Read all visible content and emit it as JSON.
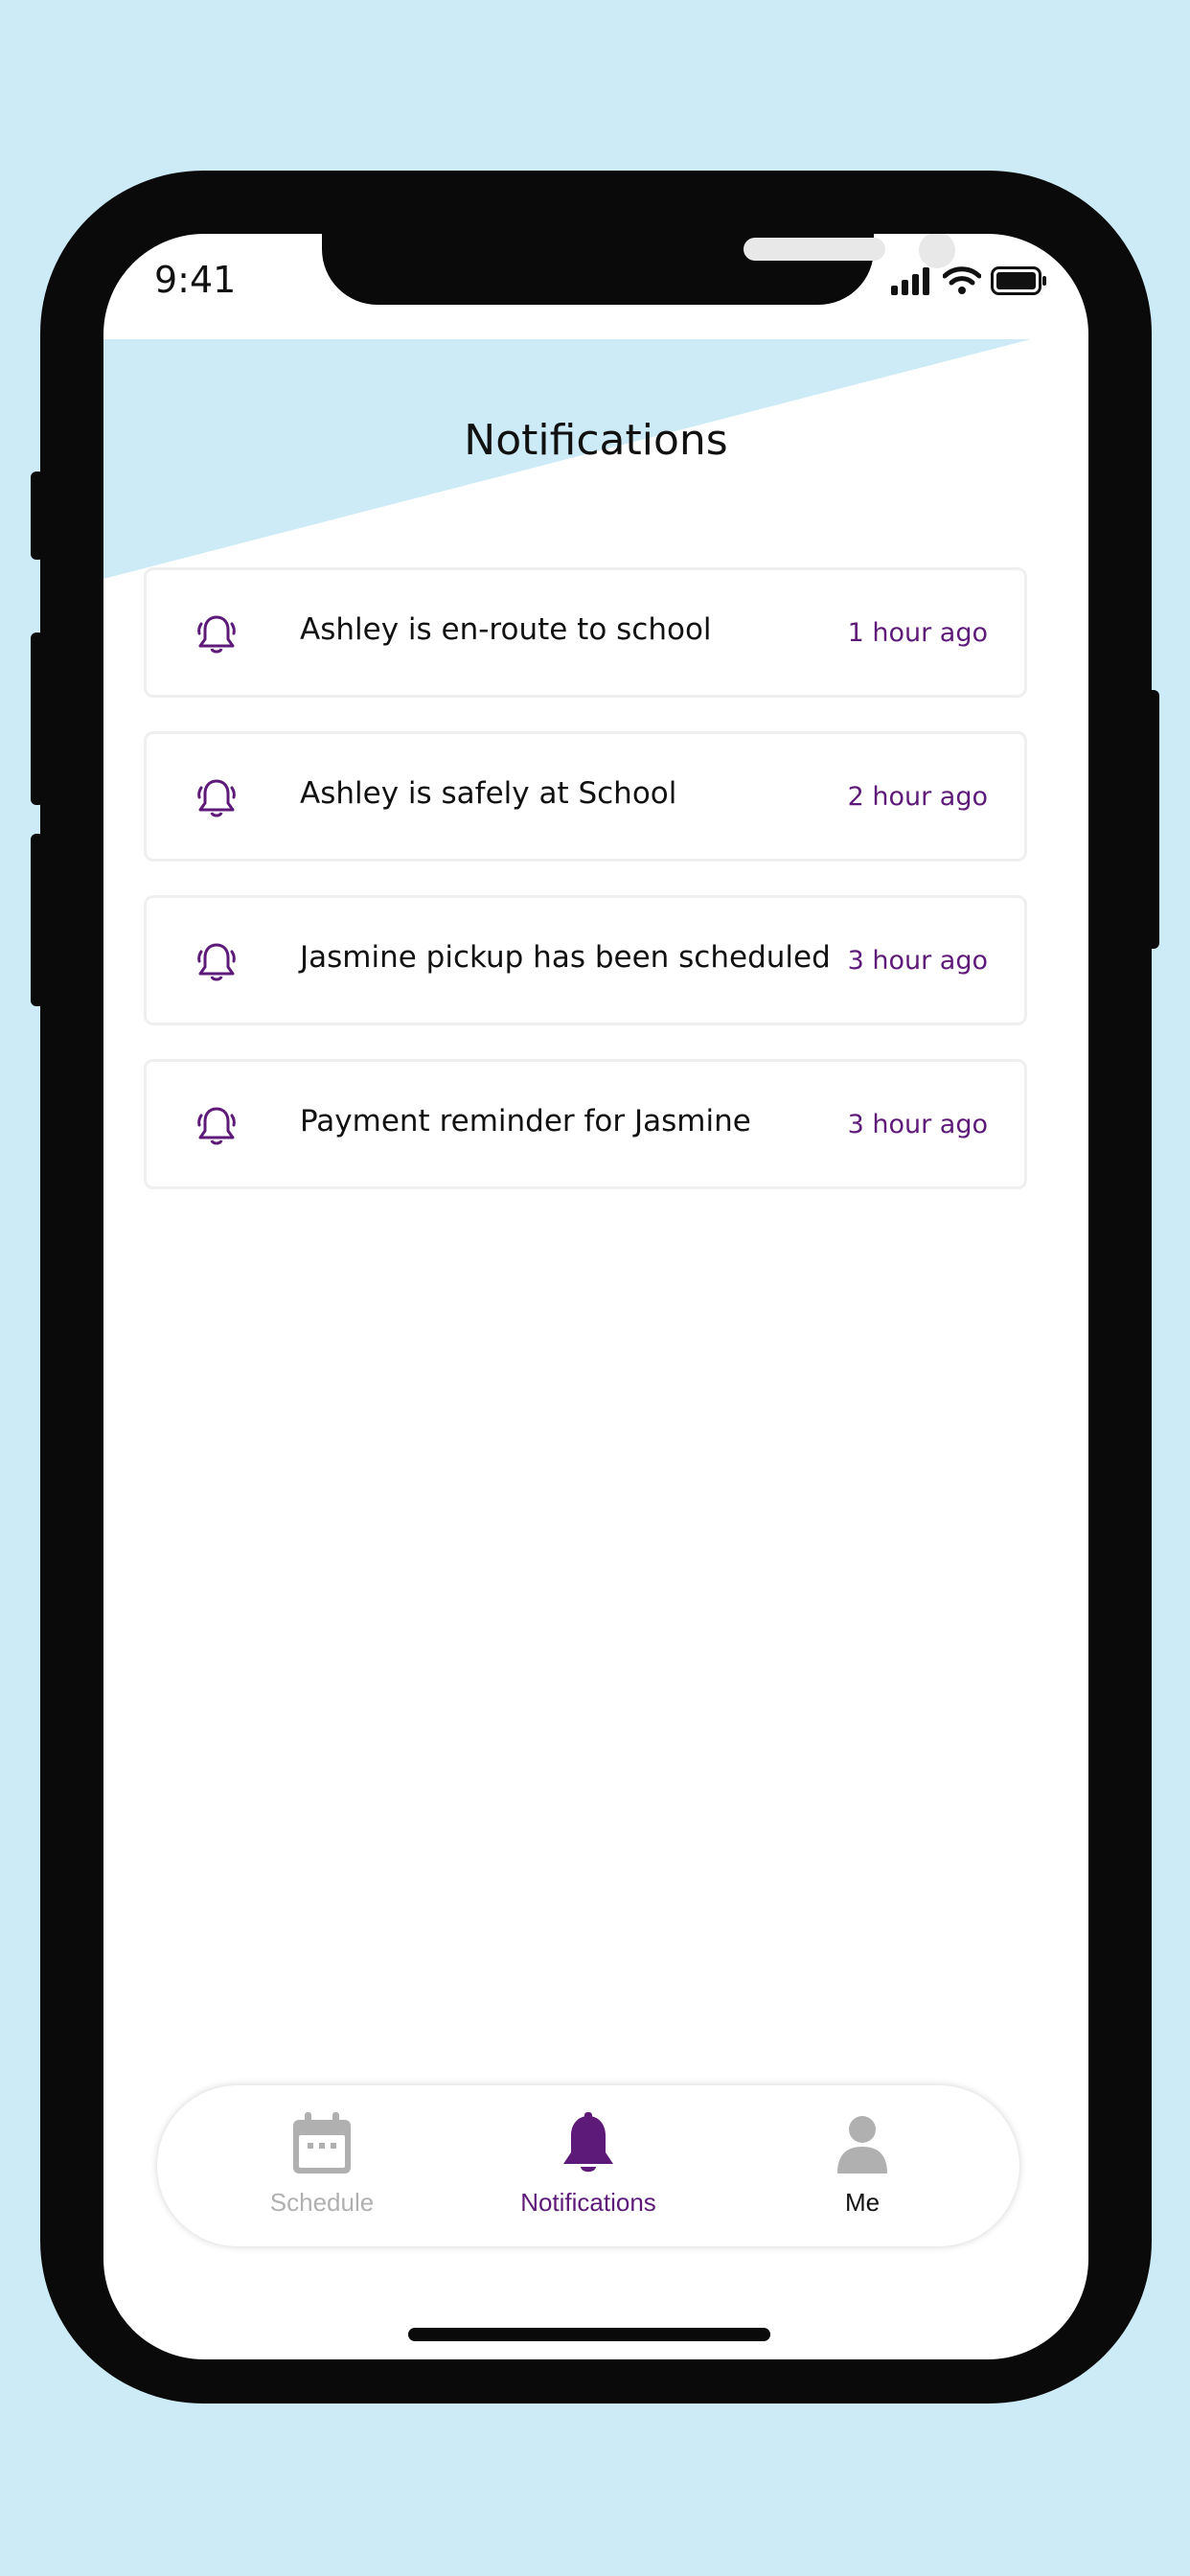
{
  "status_bar": {
    "time": "9:41"
  },
  "header": {
    "title": "Notifications"
  },
  "colors": {
    "accent": "#5e1a78",
    "background": "#cdebf7",
    "inactive": "#b0b0b0"
  },
  "notifications": [
    {
      "icon": "bell-icon",
      "text": "Ashley is en-route to school",
      "time": "1 hour ago"
    },
    {
      "icon": "bell-icon",
      "text": "Ashley is safely at School",
      "time": "2 hour ago"
    },
    {
      "icon": "bell-icon",
      "text": "Jasmine pickup has been scheduled",
      "time": "3 hour ago"
    },
    {
      "icon": "bell-icon",
      "text": "Payment reminder for Jasmine",
      "time": "3 hour ago"
    }
  ],
  "tab_bar": {
    "schedule": {
      "label": "Schedule",
      "icon": "calendar-icon"
    },
    "notifications": {
      "label": "Notifications",
      "icon": "bell-icon",
      "active": true
    },
    "me": {
      "label": "Me",
      "icon": "person-icon"
    }
  }
}
